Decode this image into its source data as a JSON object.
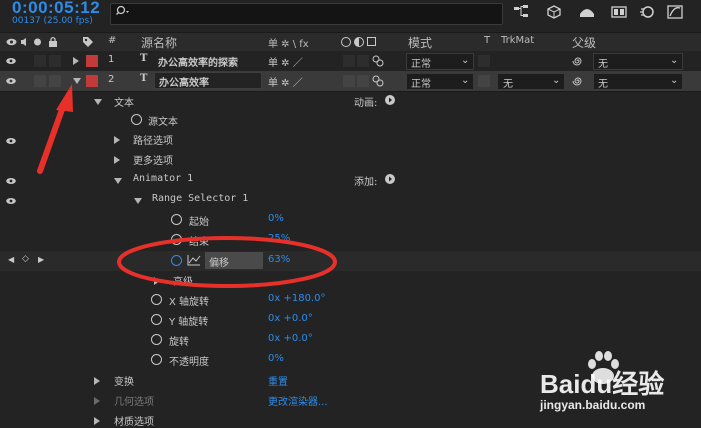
{
  "header": {
    "timecode": "0:00:05:12",
    "frame_info": "00137 (25.00 fps)",
    "search": {
      "placeholder": ""
    }
  },
  "columns": {
    "number": "#",
    "source_name": "源名称",
    "switches": "单 ✲ \\ fx",
    "mode": "模式",
    "t": "T",
    "trkmat": "TrkMat",
    "parent": "父级"
  },
  "layers": [
    {
      "index": "1",
      "type": "T",
      "name": "办公高效率的探索",
      "mode": "正常",
      "trkmat": "",
      "parent": "无",
      "label_color": "#c23a3a"
    },
    {
      "index": "2",
      "type": "T",
      "name": "办公高效率",
      "mode": "正常",
      "trkmat": "无",
      "parent": "无",
      "label_color": "#c23a3a"
    }
  ],
  "properties": {
    "text_group": "文本",
    "animate_label": "动画:",
    "source_text": "源文本",
    "path_options": "路径选项",
    "more_options": "更多选项",
    "animator": "Animator 1",
    "add_label": "添加:",
    "range_selector": "Range Selector 1",
    "start": {
      "label": "起始",
      "value": "0%"
    },
    "end": {
      "label": "结束",
      "value": "25%"
    },
    "offset": {
      "label": "偏移",
      "value": "63%"
    },
    "advanced": "高级",
    "x_rotation": {
      "label": "X 轴旋转",
      "value": "0x +180.0°"
    },
    "y_rotation": {
      "label": "Y 轴旋转",
      "value": "0x +0.0°"
    },
    "rotation": {
      "label": "旋转",
      "value": "0x +0.0°"
    },
    "opacity": {
      "label": "不透明度",
      "value": "0%"
    },
    "transform": {
      "label": "变换",
      "value": "重置"
    },
    "geometry": {
      "label": "几何选项",
      "value": "更改渲染器..."
    },
    "material": {
      "label": "材质选项"
    }
  },
  "watermark": {
    "brand": "Baidu经验",
    "url": "jingyan.baidu.com"
  },
  "colors": {
    "accent": "#2d8ceb",
    "label_red": "#c23a3a",
    "annotation_red": "#e8302a"
  }
}
